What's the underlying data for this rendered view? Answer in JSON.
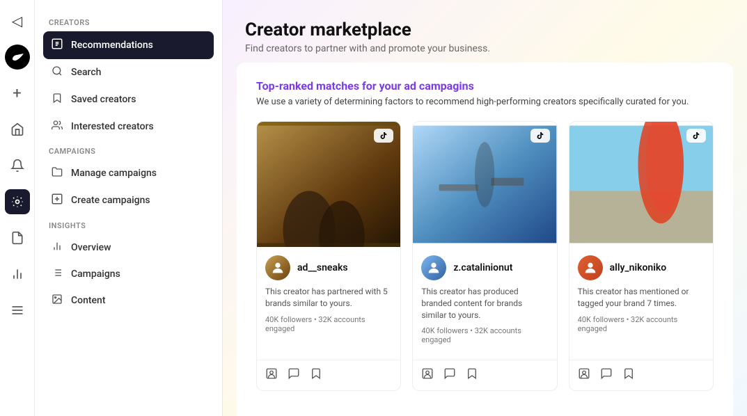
{
  "app": {
    "logo": "✓",
    "title": "Creator marketplace",
    "subtitle": "Find creators to partner with and promote your business."
  },
  "iconBar": {
    "items": [
      {
        "name": "back-icon",
        "icon": "◁",
        "active": false
      },
      {
        "name": "nike-logo",
        "icon": "✓",
        "active": true,
        "special": "nike"
      },
      {
        "name": "plus-icon",
        "icon": "+",
        "active": false
      },
      {
        "name": "home-icon",
        "icon": "⌂",
        "active": false
      },
      {
        "name": "bell-icon",
        "icon": "🔔",
        "active": false
      },
      {
        "name": "creator-marketplace-icon",
        "icon": "◈",
        "active": true
      },
      {
        "name": "campaigns-icon",
        "icon": "📋",
        "active": false
      },
      {
        "name": "insights-icon",
        "icon": "📊",
        "active": false
      },
      {
        "name": "menu-icon",
        "icon": "☰",
        "active": false
      }
    ]
  },
  "sidebar": {
    "creators_section": "Creators",
    "campaigns_section": "Campaigns",
    "insights_section": "Insights",
    "items": {
      "creators": [
        {
          "id": "recommendations",
          "label": "Recommendations",
          "icon": "📋",
          "active": true
        },
        {
          "id": "search",
          "label": "Search",
          "icon": "🔍",
          "active": false
        },
        {
          "id": "saved-creators",
          "label": "Saved creators",
          "icon": "🔖",
          "active": false
        },
        {
          "id": "interested-creators",
          "label": "Interested creators",
          "icon": "👥",
          "active": false
        }
      ],
      "campaigns": [
        {
          "id": "manage-campaigns",
          "label": "Manage campaigns",
          "icon": "📁",
          "active": false
        },
        {
          "id": "create-campaigns",
          "label": "Create campaigns",
          "icon": "➕",
          "active": false
        }
      ],
      "insights": [
        {
          "id": "overview",
          "label": "Overview",
          "icon": "📊",
          "active": false
        },
        {
          "id": "campaigns-insights",
          "label": "Campaigns",
          "icon": "☰",
          "active": false
        },
        {
          "id": "content",
          "label": "Content",
          "icon": "🖼",
          "active": false
        }
      ]
    }
  },
  "main": {
    "section_title": "Top-ranked matches for your ad campagins",
    "section_subtitle": "We use a variety of determining factors to recommend high-performing creators specifically curated for you.",
    "creators": [
      {
        "id": "ad_sneaks",
        "handle": "ad__sneaks",
        "avatar_emoji": "🧑",
        "description": "This creator has partnered with 5 brands similar to yours.",
        "followers": "40K followers • 32K accounts engaged"
      },
      {
        "id": "z_catalinionut",
        "handle": "z.catalinionut",
        "avatar_emoji": "🧑",
        "description": "This creator has produced branded content for brands similar to yours.",
        "followers": "40K followers • 32K accounts engaged"
      },
      {
        "id": "ally_nikoniko",
        "handle": "ally_nikoniko",
        "avatar_emoji": "👩",
        "description": "This creator has mentioned or tagged your brand 7 times.",
        "followers": "40K followers • 32K accounts engaged"
      }
    ],
    "action_icons": {
      "profile": "🔖",
      "message": "💬",
      "save": "🔖"
    }
  }
}
